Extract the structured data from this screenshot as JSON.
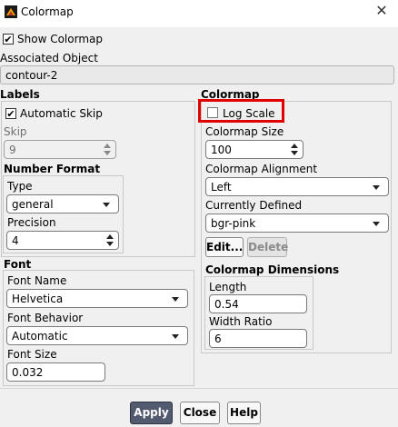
{
  "window": {
    "title": "Colormap",
    "close_glyph": "✕",
    "icon": "fluent-app-icon"
  },
  "show_colormap": {
    "label": "Show Colormap",
    "checked": true
  },
  "associated_object": {
    "label": "Associated Object",
    "value": "contour-2"
  },
  "labels": {
    "heading": "Labels",
    "automatic_skip": {
      "label": "Automatic Skip",
      "checked": true
    },
    "skip": {
      "label": "Skip",
      "value": "9"
    },
    "number_format": {
      "heading": "Number Format",
      "type_label": "Type",
      "type_value": "general",
      "precision_label": "Precision",
      "precision_value": "4"
    }
  },
  "font": {
    "heading": "Font",
    "name_label": "Font Name",
    "name_value": "Helvetica",
    "behavior_label": "Font Behavior",
    "behavior_value": "Automatic",
    "size_label": "Font Size",
    "size_value": "0.032"
  },
  "colormap": {
    "heading": "Colormap",
    "log_scale": {
      "label": "Log Scale",
      "checked": false
    },
    "size_label": "Colormap Size",
    "size_value": "100",
    "alignment_label": "Colormap Alignment",
    "alignment_value": "Left",
    "defined_label": "Currently Defined",
    "defined_value": "bgr-pink",
    "edit_label": "Edit...",
    "delete_label": "Delete",
    "dimensions": {
      "heading": "Colormap Dimensions",
      "length_label": "Length",
      "length_value": "0.54",
      "width_ratio_label": "Width Ratio",
      "width_ratio_value": "6"
    }
  },
  "buttons": {
    "apply": "Apply",
    "close": "Close",
    "help": "Help"
  },
  "colors": {
    "highlight": "#e00000",
    "apply_bg": "#515a6e"
  }
}
